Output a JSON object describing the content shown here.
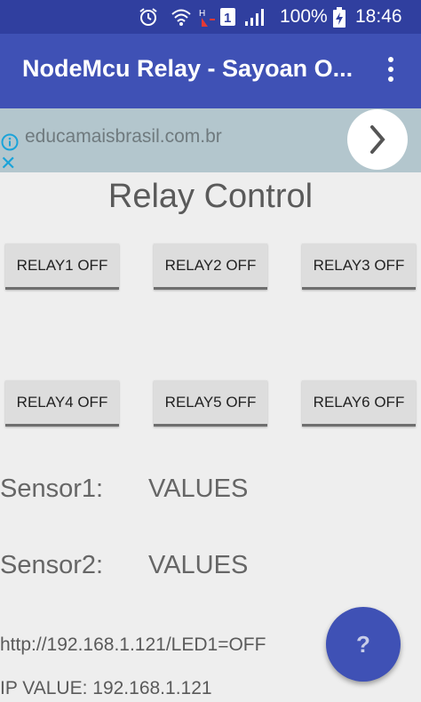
{
  "status_bar": {
    "icons": [
      "alarm-icon",
      "wifi-icon",
      "signal-h-icon",
      "sim-1-icon",
      "cell-signal-icon",
      "battery-charging-icon"
    ],
    "battery": "100%",
    "time": "18:46"
  },
  "app_bar": {
    "title": "NodeMcu Relay - Sayoan O...",
    "menu_icon": "overflow-menu-icon"
  },
  "ad": {
    "url": "educamaisbrasil.com.br",
    "info_icon": "info-icon",
    "close_icon": "close-icon",
    "arrow_icon": "chevron-right-icon"
  },
  "main": {
    "title": "Relay Control",
    "relays": [
      {
        "label": "RELAY1 OFF"
      },
      {
        "label": "RELAY2 OFF"
      },
      {
        "label": "RELAY3 OFF"
      },
      {
        "label": "RELAY4 OFF"
      },
      {
        "label": "RELAY5 OFF"
      },
      {
        "label": "RELAY6 OFF"
      }
    ],
    "sensors": [
      {
        "label": "Sensor1:",
        "value": "VALUES"
      },
      {
        "label": "Sensor2:",
        "value": "VALUES"
      }
    ],
    "url_line": "http://192.168.1.121/LED1=OFF",
    "ip_line": "IP VALUE: 192.168.1.121"
  },
  "fab": {
    "label": "?"
  },
  "colors": {
    "status_bar": "#303f9f",
    "app_bar": "#3f51b5",
    "background": "#eeeeee",
    "button": "#dddddd"
  }
}
